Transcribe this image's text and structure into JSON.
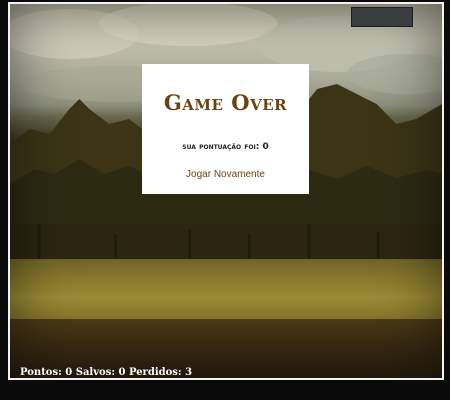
{
  "game_over": {
    "title": "Game Over",
    "score_text": "sua pontuação foi: 0",
    "play_again_label": "Jogar Novamente"
  },
  "status": {
    "text": "Pontos: 0 Salvos: 0 Perdidos: 3"
  },
  "colors": {
    "title": "#6b4310",
    "dialog_bg": "#ffffff",
    "border": "#f2f2f2",
    "status_text": "#ffffff"
  }
}
